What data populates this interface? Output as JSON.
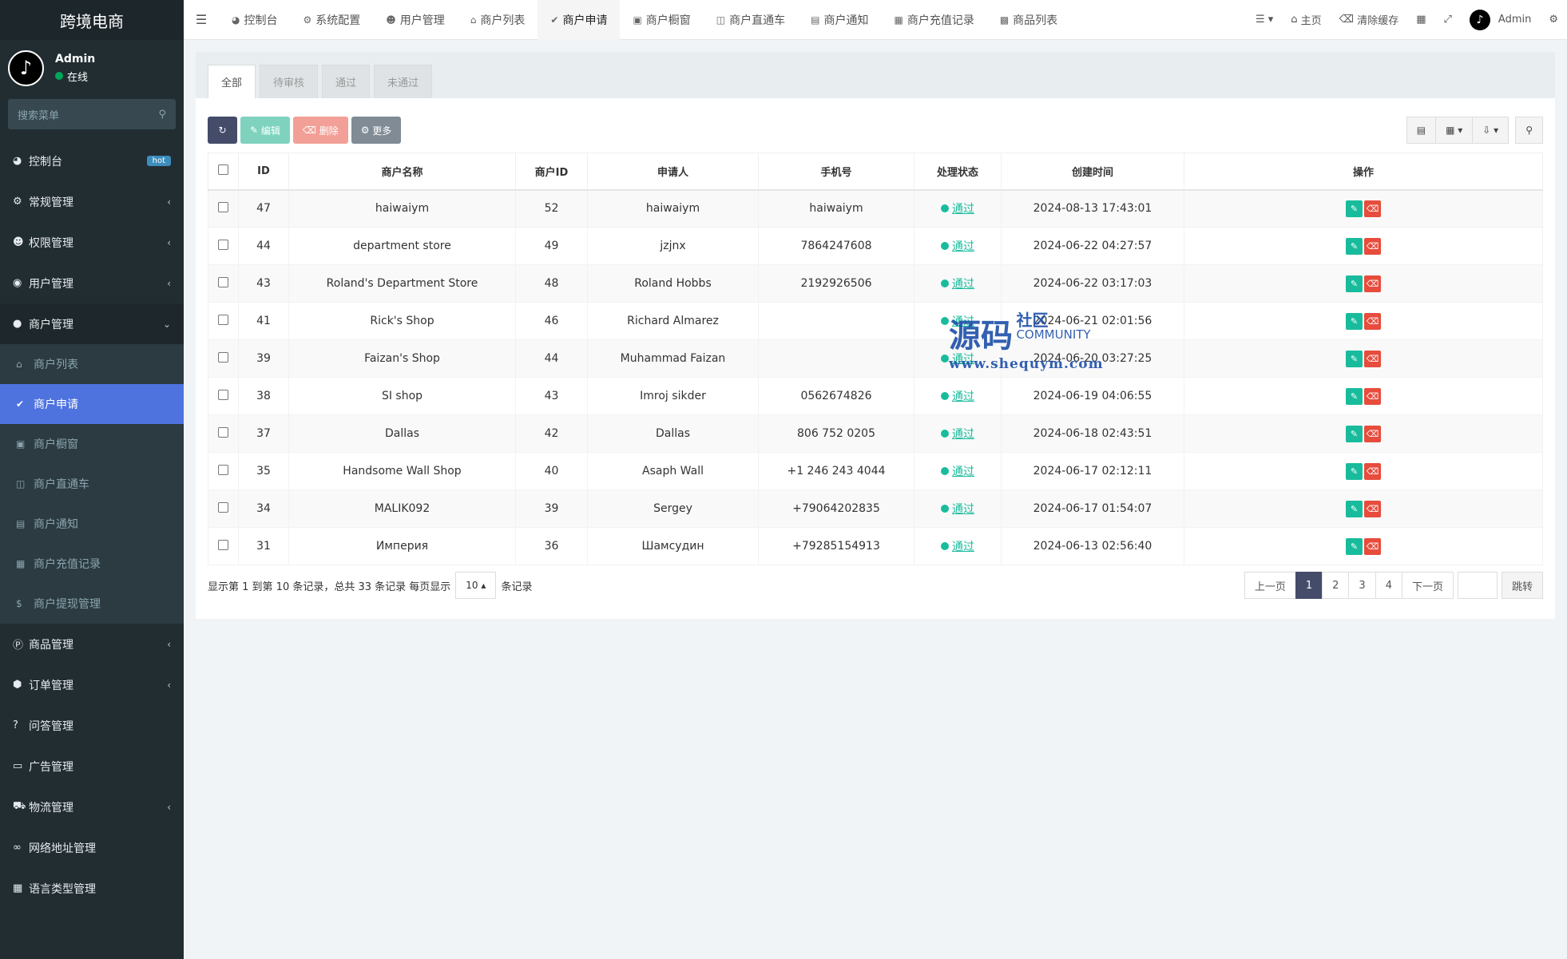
{
  "sidebar": {
    "logo": "跨境电商",
    "user_name": "Admin",
    "user_status": "在线",
    "search_placeholder": "搜索菜单",
    "menu": [
      {
        "label": "控制台",
        "icon": "dashboard-icon",
        "badge": "hot"
      },
      {
        "label": "常规管理",
        "icon": "cogs-icon"
      },
      {
        "label": "权限管理",
        "icon": "users-icon"
      },
      {
        "label": "用户管理",
        "icon": "user-circle-icon"
      },
      {
        "label": "商户管理",
        "icon": "apple-icon"
      }
    ],
    "submenu": [
      {
        "label": "商户列表",
        "icon": "home-icon"
      },
      {
        "label": "商户申请",
        "icon": "check-circle-icon"
      },
      {
        "label": "商户橱窗",
        "icon": "cart-icon"
      },
      {
        "label": "商户直通车",
        "icon": "car-icon"
      },
      {
        "label": "商户通知",
        "icon": "notice-icon"
      },
      {
        "label": "商户充值记录",
        "icon": "money-icon"
      },
      {
        "label": "商户提现管理",
        "icon": "dollar-icon"
      }
    ],
    "menu_bottom": [
      {
        "label": "商品管理",
        "icon": "product-icon"
      },
      {
        "label": "订单管理",
        "icon": "cube-icon"
      },
      {
        "label": "问答管理",
        "icon": "question-icon"
      },
      {
        "label": "广告管理",
        "icon": "ad-icon"
      },
      {
        "label": "物流管理",
        "icon": "truck-icon"
      },
      {
        "label": "网络地址管理",
        "icon": "link-icon"
      },
      {
        "label": "语言类型管理",
        "icon": "language-icon"
      }
    ]
  },
  "topbar": {
    "tabs": [
      {
        "label": "控制台",
        "icon": "dashboard-icon"
      },
      {
        "label": "系统配置",
        "icon": "cog-icon"
      },
      {
        "label": "用户管理",
        "icon": "user-icon"
      },
      {
        "label": "商户列表",
        "icon": "home-icon"
      },
      {
        "label": "商户申请",
        "icon": "check-circle-icon"
      },
      {
        "label": "商户橱窗",
        "icon": "cart-icon"
      },
      {
        "label": "商户直通车",
        "icon": "car-icon"
      },
      {
        "label": "商户通知",
        "icon": "notice-icon"
      },
      {
        "label": "商户充值记录",
        "icon": "money-icon"
      },
      {
        "label": "商品列表",
        "icon": "bag-icon"
      }
    ],
    "home": "主页",
    "clear_cache": "清除缓存",
    "admin": "Admin"
  },
  "page_tabs": [
    "全部",
    "待审核",
    "通过",
    "未通过"
  ],
  "toolbar": {
    "edit": "编辑",
    "delete": "删除",
    "more": "更多"
  },
  "table": {
    "headers": [
      "ID",
      "商户名称",
      "商户ID",
      "申请人",
      "手机号",
      "处理状态",
      "创建时间",
      "操作"
    ],
    "rows": [
      {
        "id": "47",
        "name": "haiwaiym",
        "mid": "52",
        "applicant": "haiwaiym",
        "phone": "haiwaiym",
        "status": "通过",
        "created": "2024-08-13 17:43:01"
      },
      {
        "id": "44",
        "name": "department store",
        "mid": "49",
        "applicant": "jzjnx",
        "phone": "7864247608",
        "status": "通过",
        "created": "2024-06-22 04:27:57"
      },
      {
        "id": "43",
        "name": "Roland's Department Store",
        "mid": "48",
        "applicant": "Roland Hobbs",
        "phone": "2192926506",
        "status": "通过",
        "created": "2024-06-22 03:17:03"
      },
      {
        "id": "41",
        "name": "Rick's Shop",
        "mid": "46",
        "applicant": "Richard Almarez",
        "phone": "",
        "status": "通过",
        "created": "2024-06-21 02:01:56"
      },
      {
        "id": "39",
        "name": "Faizan's Shop",
        "mid": "44",
        "applicant": "Muhammad Faizan",
        "phone": "",
        "status": "通过",
        "created": "2024-06-20 03:27:25"
      },
      {
        "id": "38",
        "name": "SI shop",
        "mid": "43",
        "applicant": "Imroj sikder",
        "phone": "0562674826",
        "status": "通过",
        "created": "2024-06-19 04:06:55"
      },
      {
        "id": "37",
        "name": "Dallas",
        "mid": "42",
        "applicant": "Dallas",
        "phone": "806 752 0205",
        "status": "通过",
        "created": "2024-06-18 02:43:51"
      },
      {
        "id": "35",
        "name": "Handsome Wall Shop",
        "mid": "40",
        "applicant": "Asaph Wall",
        "phone": "+1 246 243 4044",
        "status": "通过",
        "created": "2024-06-17 02:12:11"
      },
      {
        "id": "34",
        "name": "MALIK092",
        "mid": "39",
        "applicant": "Sergey",
        "phone": "+79064202835",
        "status": "通过",
        "created": "2024-06-17 01:54:07"
      },
      {
        "id": "31",
        "name": "Империя",
        "mid": "36",
        "applicant": "Шамсудин",
        "phone": "+79285154913",
        "status": "通过",
        "created": "2024-06-13 02:56:40"
      }
    ]
  },
  "footer": {
    "summary": "显示第 1 到第 10 条记录，总共 33 条记录 每页显示",
    "page_size": "10",
    "suffix": "条记录",
    "prev": "上一页",
    "pages": [
      "1",
      "2",
      "3",
      "4"
    ],
    "next": "下一页",
    "jump": "跳转"
  },
  "watermark": {
    "big": "源码",
    "cn": "社区",
    "en": "COMMUNITY",
    "url": "www.shequym.com"
  },
  "colors": {
    "sidebar_bg": "#222d32",
    "active_item": "#4e73df",
    "status_green": "#18bc9c",
    "delete_red": "#e74c3c",
    "primary_dark": "#444c69"
  }
}
